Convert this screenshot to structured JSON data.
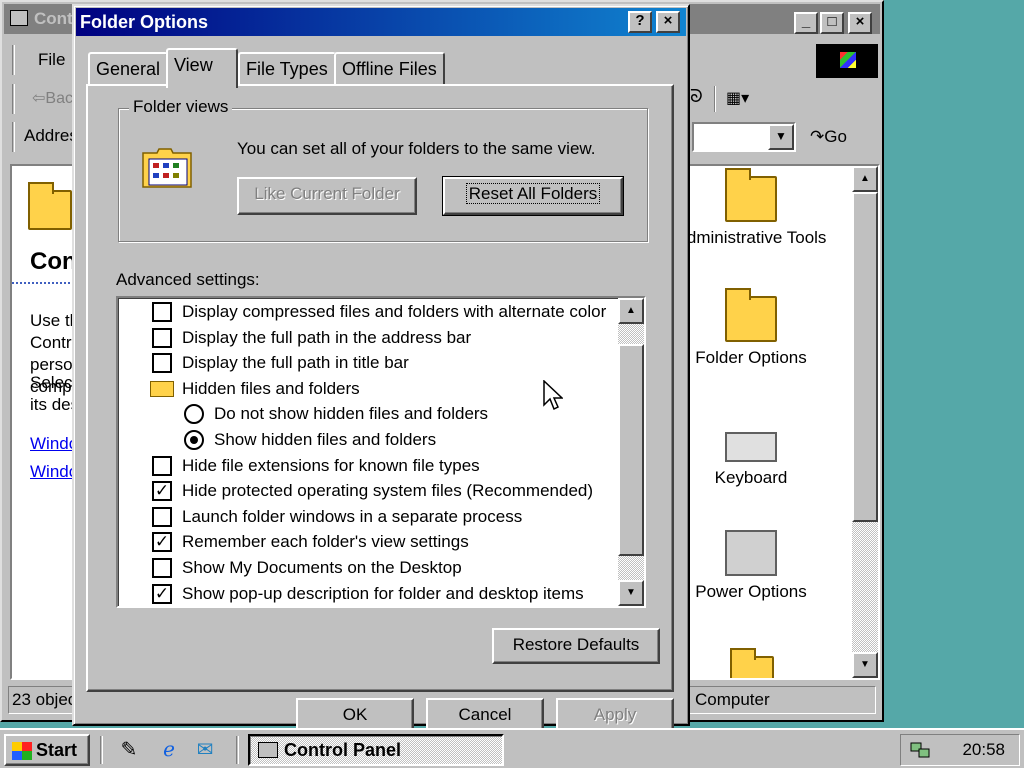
{
  "control_panel": {
    "title": "Control Panel",
    "menu": {
      "file": "File"
    },
    "toolbar": {
      "back": "Back",
      "address_label": "Address",
      "go": "Go"
    },
    "left_panel": {
      "heading": "Control Panel",
      "text1": "Use the settings in Control Panel to personalize your computer.",
      "text2": "Select an item to view its description.",
      "link1": "Windows Update",
      "link2": "Windows 2000 Support"
    },
    "icons": [
      {
        "label": "Administrative Tools"
      },
      {
        "label": "Folder Options"
      },
      {
        "label": "Keyboard"
      },
      {
        "label": "Power Options"
      }
    ],
    "status": {
      "objects": "23 objects",
      "zone": "My Computer",
      "zone_visible": "Computer"
    }
  },
  "dialog": {
    "title": "Folder Options",
    "tabs": [
      "General",
      "View",
      "File Types",
      "Offline Files"
    ],
    "active_tab": "View",
    "folder_views": {
      "group_label": "Folder views",
      "description": "You can set all of your folders to the same view.",
      "like_current": "Like Current Folder",
      "reset_all": "Reset All Folders"
    },
    "advanced_label": "Advanced settings:",
    "settings": [
      {
        "type": "checkbox",
        "label": "Display compressed files and folders with alternate color",
        "checked": false
      },
      {
        "type": "checkbox",
        "label": "Display the full path in the address bar",
        "checked": false
      },
      {
        "type": "checkbox",
        "label": "Display the full path in title bar",
        "checked": false
      },
      {
        "type": "folder",
        "label": "Hidden files and folders"
      },
      {
        "type": "radio",
        "label": "Do not show hidden files and folders",
        "checked": false
      },
      {
        "type": "radio",
        "label": "Show hidden files and folders",
        "checked": true
      },
      {
        "type": "checkbox",
        "label": "Hide file extensions for known file types",
        "checked": false
      },
      {
        "type": "checkbox",
        "label": "Hide protected operating system files (Recommended)",
        "checked": true
      },
      {
        "type": "checkbox",
        "label": "Launch folder windows in a separate process",
        "checked": false
      },
      {
        "type": "checkbox",
        "label": "Remember each folder's view settings",
        "checked": true
      },
      {
        "type": "checkbox",
        "label": "Show My Documents on the Desktop",
        "checked": false
      },
      {
        "type": "checkbox",
        "label": "Show pop-up description for folder and desktop items",
        "checked": true
      }
    ],
    "restore_defaults": "Restore Defaults",
    "buttons": {
      "ok": "OK",
      "cancel": "Cancel",
      "apply": "Apply"
    },
    "help_glyph": "?",
    "close_glyph": "×"
  },
  "taskbar": {
    "start": "Start",
    "task_label": "Control Panel",
    "clock": "20:58"
  }
}
